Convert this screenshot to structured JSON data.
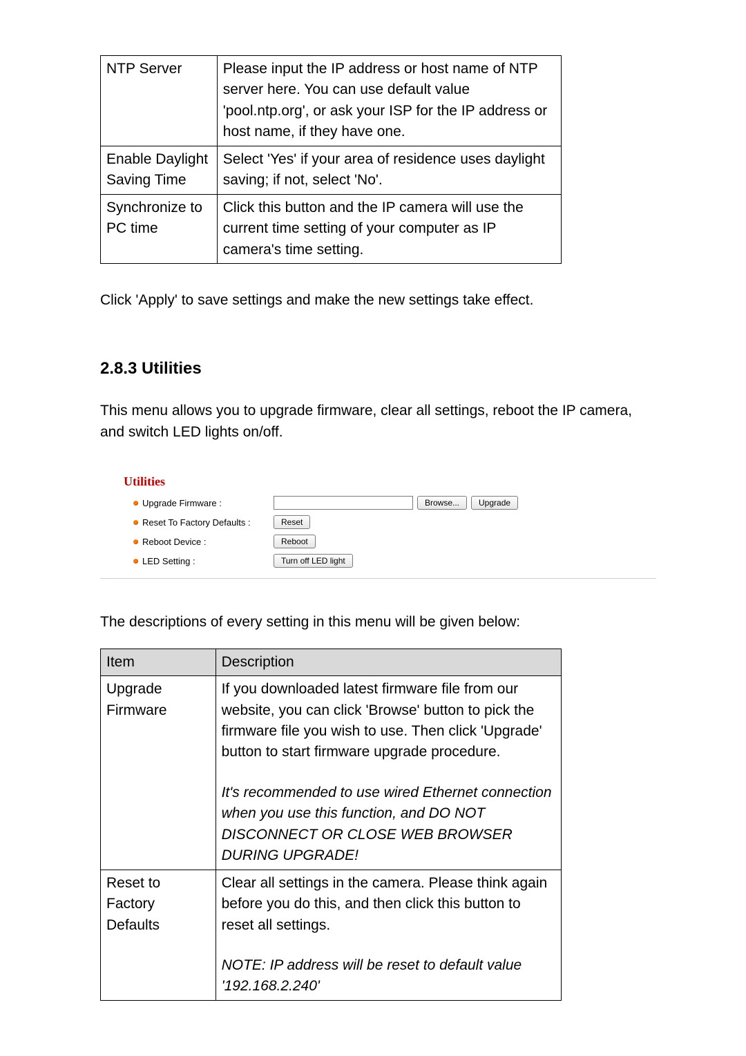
{
  "table1": {
    "rows": [
      {
        "item": "NTP Server",
        "desc": "Please input the IP address or host name of NTP server here. You can use default value 'pool.ntp.org', or ask your ISP for the IP address or host name, if they have one."
      },
      {
        "item": "Enable Daylight Saving Time",
        "desc": "Select 'Yes' if your area of residence uses daylight saving; if not, select 'No'."
      },
      {
        "item": "Synchronize to PC time",
        "desc": "Click this button and the IP camera will use the current time setting of your computer as IP camera's time setting."
      }
    ]
  },
  "para_apply": "Click 'Apply' to save settings and make the new settings take effect.",
  "section_heading": "2.8.3 Utilities",
  "para_intro": "This menu allows you to upgrade firmware, clear all settings, reboot the IP camera, and switch LED lights on/off.",
  "shot": {
    "title": "Utilities",
    "rows": {
      "upgrade": {
        "label": "Upgrade Firmware :",
        "browse": "Browse...",
        "upgrade": "Upgrade"
      },
      "reset": {
        "label": "Reset To Factory Defaults :",
        "btn": "Reset"
      },
      "reboot": {
        "label": "Reboot Device :",
        "btn": "Reboot"
      },
      "led": {
        "label": "LED Setting :",
        "btn": "Turn off LED light"
      }
    }
  },
  "para_below": "The descriptions of every setting in this menu will be given below:",
  "table2": {
    "head": {
      "item": "Item",
      "desc": "Description"
    },
    "r1": {
      "item": "Upgrade Firmware",
      "p1": "If you downloaded latest firmware file from our website, you can click 'Browse' button to pick the firmware file you wish to use. Then click 'Upgrade' button to start firmware upgrade procedure.",
      "p2": "It's recommended to use wired Ethernet connection when you use this function, and DO NOT DISCONNECT OR CLOSE WEB BROWSER DURING UPGRADE!"
    },
    "r2": {
      "item": "Reset to Factory Defaults",
      "p1": "Clear all settings in the camera. Please think again before you do this, and then click this button to reset all settings.",
      "p2": "NOTE: IP address will be reset to default value '192.168.2.240'"
    }
  }
}
